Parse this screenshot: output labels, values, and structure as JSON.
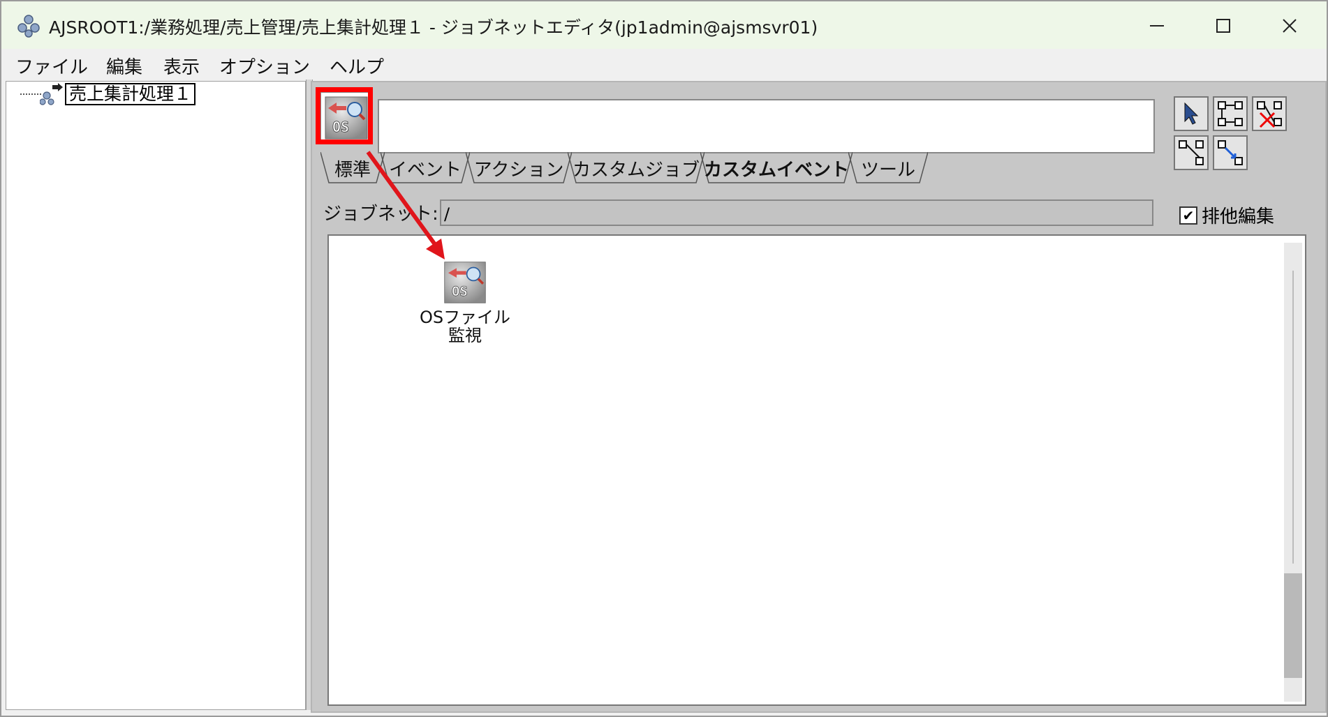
{
  "window": {
    "title": "AJSROOT1:/業務処理/売上管理/売上集計処理１ - ジョブネットエディタ(jp1admin@ajsmsvr01)",
    "controls": {
      "minimize": "—",
      "maximize": "☐",
      "close": "✕"
    }
  },
  "menu": {
    "items": [
      "ファイル",
      "編集",
      "表示",
      "オプション",
      "ヘルプ"
    ]
  },
  "tree": {
    "root_label": "売上集計処理１"
  },
  "palette": {
    "selected_icon": "os-file-monitor-icon",
    "tabs": [
      "標準",
      "イベント",
      "アクション",
      "カスタムジョブ",
      "カスタムイベント",
      "ツール"
    ],
    "active_tab": "カスタムイベント"
  },
  "jobnet": {
    "label": "ジョブネット:",
    "value": "/"
  },
  "exclusive_edit": {
    "label": "排他編集",
    "checked": true,
    "check_mark": "✔"
  },
  "canvas": {
    "item_label_line1": "OSファイル",
    "item_label_line2": "監視",
    "icon_text": "OS"
  },
  "colors": {
    "highlight": "#ff0000",
    "arrow": "#e0151b",
    "titlebar": "#eef7e8",
    "panel_gray": "#c7c7c7"
  }
}
